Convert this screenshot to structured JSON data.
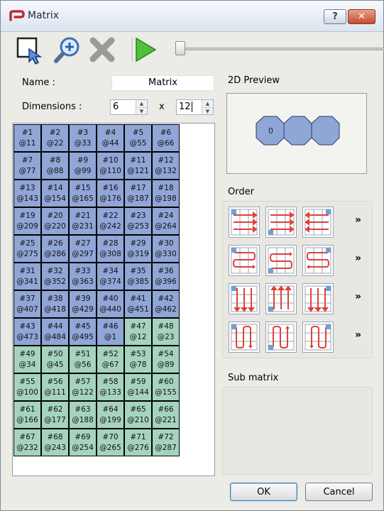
{
  "window": {
    "title": "Matrix",
    "help_label": "?",
    "close_label": "✕"
  },
  "toolbar": {
    "tools": [
      {
        "name": "select-tool",
        "icon": "select-arrow-icon"
      },
      {
        "name": "zoom-tool",
        "icon": "zoom-in-icon"
      },
      {
        "name": "delete-tool",
        "icon": "delete-icon"
      },
      {
        "name": "play-tool",
        "icon": "play-icon"
      }
    ],
    "slider_value": 0
  },
  "form": {
    "name_label": "Name :",
    "name_value": "Matrix",
    "dimensions_label": "Dimensions :",
    "dim_cols": "6",
    "dim_separator": "x",
    "dim_rows": "12"
  },
  "matrix": {
    "cells": [
      [
        "#1",
        "@11",
        "blue"
      ],
      [
        "#2",
        "@22",
        "blue"
      ],
      [
        "#3",
        "@33",
        "blue"
      ],
      [
        "#4",
        "@44",
        "blue"
      ],
      [
        "#5",
        "@55",
        "blue"
      ],
      [
        "#6",
        "@66",
        "blue"
      ],
      [
        "#7",
        "@77",
        "blue"
      ],
      [
        "#8",
        "@88",
        "blue"
      ],
      [
        "#9",
        "@99",
        "blue"
      ],
      [
        "#10",
        "@110",
        "blue"
      ],
      [
        "#11",
        "@121",
        "blue"
      ],
      [
        "#12",
        "@132",
        "blue"
      ],
      [
        "#13",
        "@143",
        "blue"
      ],
      [
        "#14",
        "@154",
        "blue"
      ],
      [
        "#15",
        "@165",
        "blue"
      ],
      [
        "#16",
        "@176",
        "blue"
      ],
      [
        "#17",
        "@187",
        "blue"
      ],
      [
        "#18",
        "@198",
        "blue"
      ],
      [
        "#19",
        "@209",
        "blue"
      ],
      [
        "#20",
        "@220",
        "blue"
      ],
      [
        "#21",
        "@231",
        "blue"
      ],
      [
        "#22",
        "@242",
        "blue"
      ],
      [
        "#23",
        "@253",
        "blue"
      ],
      [
        "#24",
        "@264",
        "blue"
      ],
      [
        "#25",
        "@275",
        "blue"
      ],
      [
        "#26",
        "@286",
        "blue"
      ],
      [
        "#27",
        "@297",
        "blue"
      ],
      [
        "#28",
        "@308",
        "blue"
      ],
      [
        "#29",
        "@319",
        "blue"
      ],
      [
        "#30",
        "@330",
        "blue"
      ],
      [
        "#31",
        "@341",
        "blue"
      ],
      [
        "#32",
        "@352",
        "blue"
      ],
      [
        "#33",
        "@363",
        "blue"
      ],
      [
        "#34",
        "@374",
        "blue"
      ],
      [
        "#35",
        "@385",
        "blue"
      ],
      [
        "#36",
        "@396",
        "blue"
      ],
      [
        "#37",
        "@407",
        "blue"
      ],
      [
        "#38",
        "@418",
        "blue"
      ],
      [
        "#39",
        "@429",
        "blue"
      ],
      [
        "#40",
        "@440",
        "blue"
      ],
      [
        "#41",
        "@451",
        "blue"
      ],
      [
        "#42",
        "@462",
        "blue"
      ],
      [
        "#43",
        "@473",
        "blue"
      ],
      [
        "#44",
        "@484",
        "blue"
      ],
      [
        "#45",
        "@495",
        "blue"
      ],
      [
        "#46",
        "@1",
        "blue"
      ],
      [
        "#47",
        "@12",
        "green"
      ],
      [
        "#48",
        "@23",
        "green"
      ],
      [
        "#49",
        "@34",
        "green"
      ],
      [
        "#50",
        "@45",
        "green"
      ],
      [
        "#51",
        "@56",
        "green"
      ],
      [
        "#52",
        "@67",
        "green"
      ],
      [
        "#53",
        "@78",
        "green"
      ],
      [
        "#54",
        "@89",
        "green"
      ],
      [
        "#55",
        "@100",
        "green"
      ],
      [
        "#56",
        "@111",
        "green"
      ],
      [
        "#57",
        "@122",
        "green"
      ],
      [
        "#58",
        "@133",
        "green"
      ],
      [
        "#59",
        "@144",
        "green"
      ],
      [
        "#60",
        "@155",
        "green"
      ],
      [
        "#61",
        "@166",
        "green"
      ],
      [
        "#62",
        "@177",
        "green"
      ],
      [
        "#63",
        "@188",
        "green"
      ],
      [
        "#64",
        "@199",
        "green"
      ],
      [
        "#65",
        "@210",
        "green"
      ],
      [
        "#66",
        "@221",
        "green"
      ],
      [
        "#67",
        "@232",
        "green"
      ],
      [
        "#68",
        "@243",
        "green"
      ],
      [
        "#69",
        "@254",
        "green"
      ],
      [
        "#70",
        "@265",
        "green"
      ],
      [
        "#71",
        "@276",
        "green"
      ],
      [
        "#72",
        "@287",
        "green"
      ]
    ]
  },
  "preview": {
    "title": "2D Preview",
    "first_label": "0"
  },
  "order": {
    "title": "Order",
    "more_label": "»",
    "rows": [
      [
        "order-rows-lr-icon",
        "order-rows-lr-rev-icon",
        "order-rows-rl-icon"
      ],
      [
        "order-snake-h-icon",
        "order-snake-h-rev-icon",
        "order-snake-h-alt-icon"
      ],
      [
        "order-cols-td-icon",
        "order-cols-alt-icon",
        "order-cols-bu-icon"
      ],
      [
        "order-snake-v-icon",
        "order-snake-v-rev-icon",
        "order-snake-v-alt-icon"
      ]
    ]
  },
  "submatrix": {
    "title": "Sub matrix"
  },
  "buttons": {
    "ok": "OK",
    "cancel": "Cancel"
  },
  "colors": {
    "cell_blue": "#8fa6d6",
    "cell_green": "#a5d3be",
    "accent_red": "#e0413a",
    "octagon": "#8fa6d6"
  }
}
